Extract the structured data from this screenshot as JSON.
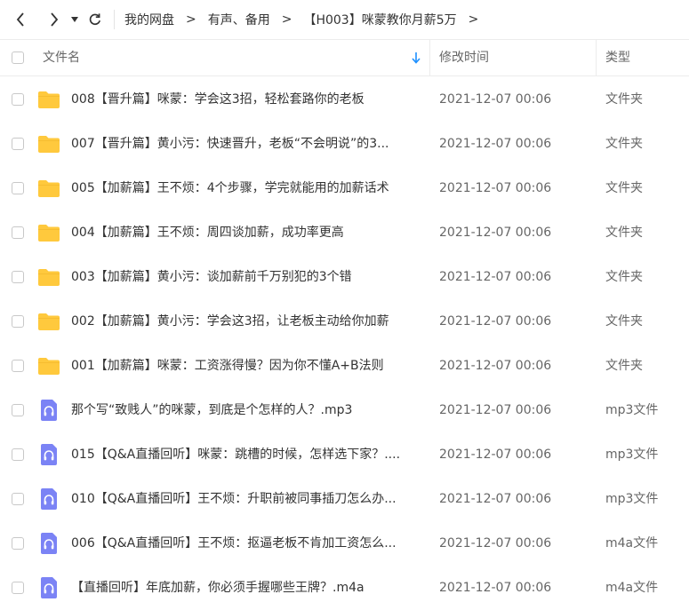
{
  "breadcrumb": {
    "items": [
      "我的网盘",
      "有声、备用",
      "【H003】咪蒙教你月薪5万"
    ],
    "separator": ">"
  },
  "columns": {
    "name": "文件名",
    "modified": "修改时间",
    "type": "类型"
  },
  "colors": {
    "folder": "#FFC93D",
    "audio": "#7B83F5",
    "sort_arrow": "#1E90FF",
    "text": "#333333",
    "muted": "#666666"
  },
  "files": [
    {
      "icon": "folder-icon",
      "name": "008【晋升篇】咪蒙：学会这3招，轻松套路你的老板",
      "date": "2021-12-07 00:06",
      "type": "文件夹"
    },
    {
      "icon": "folder-icon",
      "name": "007【晋升篇】黄小污：快速晋升，老板“不会明说”的3...",
      "date": "2021-12-07 00:06",
      "type": "文件夹"
    },
    {
      "icon": "folder-icon",
      "name": "005【加薪篇】王不烦：4个步骤，学完就能用的加薪话术",
      "date": "2021-12-07 00:06",
      "type": "文件夹"
    },
    {
      "icon": "folder-icon",
      "name": "004【加薪篇】王不烦：周四谈加薪，成功率更高",
      "date": "2021-12-07 00:06",
      "type": "文件夹"
    },
    {
      "icon": "folder-icon",
      "name": "003【加薪篇】黄小污：谈加薪前千万别犯的3个错",
      "date": "2021-12-07 00:06",
      "type": "文件夹"
    },
    {
      "icon": "folder-icon",
      "name": "002【加薪篇】黄小污：学会这3招，让老板主动给你加薪",
      "date": "2021-12-07 00:06",
      "type": "文件夹"
    },
    {
      "icon": "folder-icon",
      "name": "001【加薪篇】咪蒙：工资涨得慢？因为你不懂A+B法则",
      "date": "2021-12-07 00:06",
      "type": "文件夹"
    },
    {
      "icon": "audio-file-icon",
      "name": "那个写“致贱人”的咪蒙，到底是个怎样的人？.mp3",
      "date": "2021-12-07 00:06",
      "type": "mp3文件"
    },
    {
      "icon": "audio-file-icon",
      "name": "015【Q&A直播回听】咪蒙：跳槽的时候，怎样选下家？....",
      "date": "2021-12-07 00:06",
      "type": "mp3文件"
    },
    {
      "icon": "audio-file-icon",
      "name": "010【Q&A直播回听】王不烦：升职前被同事插刀怎么办...",
      "date": "2021-12-07 00:06",
      "type": "mp3文件"
    },
    {
      "icon": "audio-file-icon",
      "name": "006【Q&A直播回听】王不烦：抠逼老板不肯加工资怎么...",
      "date": "2021-12-07 00:06",
      "type": "m4a文件"
    },
    {
      "icon": "audio-file-icon",
      "name": "【直播回听】年底加薪，你必须手握哪些王牌？.m4a",
      "date": "2021-12-07 00:06",
      "type": "m4a文件"
    }
  ]
}
